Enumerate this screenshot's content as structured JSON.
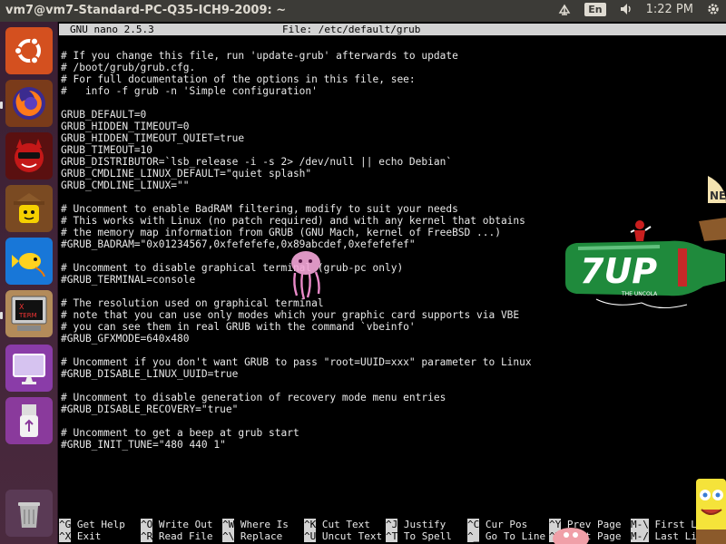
{
  "window": {
    "title": "vm7@vm7-Standard-PC-Q35-ICH9-2009: ~"
  },
  "panel": {
    "language": "En",
    "time": "1:22 PM"
  },
  "launcher": {
    "items": [
      {
        "name": "ubuntu-dash"
      },
      {
        "name": "firefox"
      },
      {
        "name": "red-devil-app"
      },
      {
        "name": "lego-figure-app"
      },
      {
        "name": "fish-app"
      },
      {
        "name": "xterm"
      },
      {
        "name": "display-settings"
      },
      {
        "name": "usb-drive"
      },
      {
        "name": "trash"
      }
    ],
    "xterm_label": "X\nTERM"
  },
  "nano": {
    "version": "GNU nano 2.5.3",
    "file": "File: /etc/default/grub",
    "lines": [
      "# If you change this file, run 'update-grub' afterwards to update",
      "# /boot/grub/grub.cfg.",
      "# For full documentation of the options in this file, see:",
      "#   info -f grub -n 'Simple configuration'",
      "",
      "GRUB_DEFAULT=0",
      "GRUB_HIDDEN_TIMEOUT=0",
      "GRUB_HIDDEN_TIMEOUT_QUIET=true",
      "GRUB_TIMEOUT=10",
      "GRUB_DISTRIBUTOR=`lsb_release -i -s 2> /dev/null || echo Debian`",
      "GRUB_CMDLINE_LINUX_DEFAULT=\"quiet splash\"",
      "GRUB_CMDLINE_LINUX=\"\"",
      "",
      "# Uncomment to enable BadRAM filtering, modify to suit your needs",
      "# This works with Linux (no patch required) and with any kernel that obtains",
      "# the memory map information from GRUB (GNU Mach, kernel of FreeBSD ...)",
      "#GRUB_BADRAM=\"0x01234567,0xfefefefe,0x89abcdef,0xefefefef\"",
      "",
      "# Uncomment to disable graphical terminal (grub-pc only)",
      "#GRUB_TERMINAL=console",
      "",
      "# The resolution used on graphical terminal",
      "# note that you can use only modes which your graphic card supports via VBE",
      "# you can see them in real GRUB with the command `vbeinfo'",
      "#GRUB_GFXMODE=640x480",
      "",
      "# Uncomment if you don't want GRUB to pass \"root=UUID=xxx\" parameter to Linux",
      "#GRUB_DISABLE_LINUX_UUID=true",
      "",
      "# Uncomment to disable generation of recovery mode menu entries",
      "#GRUB_DISABLE_RECOVERY=\"true\"",
      "",
      "# Uncomment to get a beep at grub start",
      "#GRUB_INIT_TUNE=\"480 440 1\""
    ],
    "shortcuts": [
      [
        {
          "key": "^G",
          "label": "Get Help"
        },
        {
          "key": "^O",
          "label": "Write Out"
        },
        {
          "key": "^W",
          "label": "Where Is"
        },
        {
          "key": "^K",
          "label": "Cut Text"
        },
        {
          "key": "^J",
          "label": "Justify"
        },
        {
          "key": "^C",
          "label": "Cur Pos"
        },
        {
          "key": "^Y",
          "label": "Prev Page"
        },
        {
          "key": "M-\\",
          "label": "First Lin"
        }
      ],
      [
        {
          "key": "^X",
          "label": "Exit"
        },
        {
          "key": "^R",
          "label": "Read File"
        },
        {
          "key": "^\\",
          "label": "Replace"
        },
        {
          "key": "^U",
          "label": "Uncut Text"
        },
        {
          "key": "^T",
          "label": "To Spell"
        },
        {
          "key": "^_",
          "label": "Go To Line"
        },
        {
          "key": "^V",
          "label": "Next Page"
        },
        {
          "key": "M-/",
          "label": "Last Line"
        }
      ]
    ]
  },
  "screenmates": {
    "bottle_text": "7UP",
    "bottle_subtext": "THE UNCOLA",
    "ship_text": "NE"
  },
  "colors": {
    "panel": "#3c3b37",
    "launcher": "#3a1f33",
    "nano_header": "#d3d3d3",
    "bottle_green": "#1f8a3c"
  }
}
